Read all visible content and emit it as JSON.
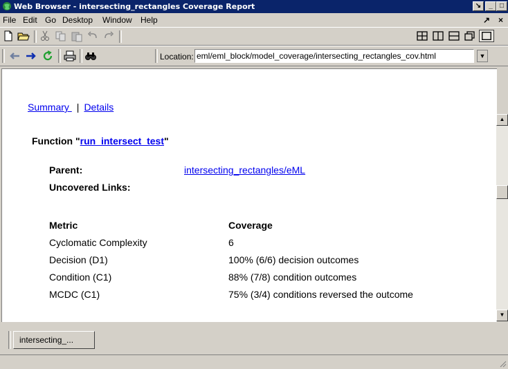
{
  "window": {
    "title": "Web Browser - intersecting_rectangles Coverage Report",
    "buttons": [
      "↘",
      "_",
      "□",
      "×"
    ]
  },
  "menu": {
    "items": [
      "File",
      "Edit",
      "Go",
      "Desktop",
      "Window",
      "Help"
    ],
    "right": [
      "↗",
      "×"
    ]
  },
  "location": {
    "label": "Location:",
    "value": "eml/eml_block/model_coverage/intersecting_rectangles_cov.html"
  },
  "page": {
    "nav": {
      "summary": "Summary ",
      "sep": "|",
      "details": "Details "
    },
    "function_prefix": "Function \"",
    "function_name": "run_intersect_test",
    "function_suffix": "\"",
    "parent_label": "Parent:",
    "parent_value": "intersecting_rectangles/eML",
    "uncovered_label": "Uncovered Links:",
    "metric_header": "Metric",
    "coverage_header": "Coverage",
    "metrics": [
      {
        "name": "Cyclomatic Complexity",
        "value": "6"
      },
      {
        "name": "Decision (D1)",
        "value": "100% (6/6) decision outcomes"
      },
      {
        "name": "Condition (C1)",
        "value": "88% (7/8) condition outcomes"
      },
      {
        "name": "MCDC (C1)",
        "value": "75% (3/4) conditions reversed the outcome"
      }
    ]
  },
  "tab": {
    "label": "intersecting_..."
  },
  "colors": {
    "link": "#0000ee",
    "titlebar": "#0a246a"
  }
}
